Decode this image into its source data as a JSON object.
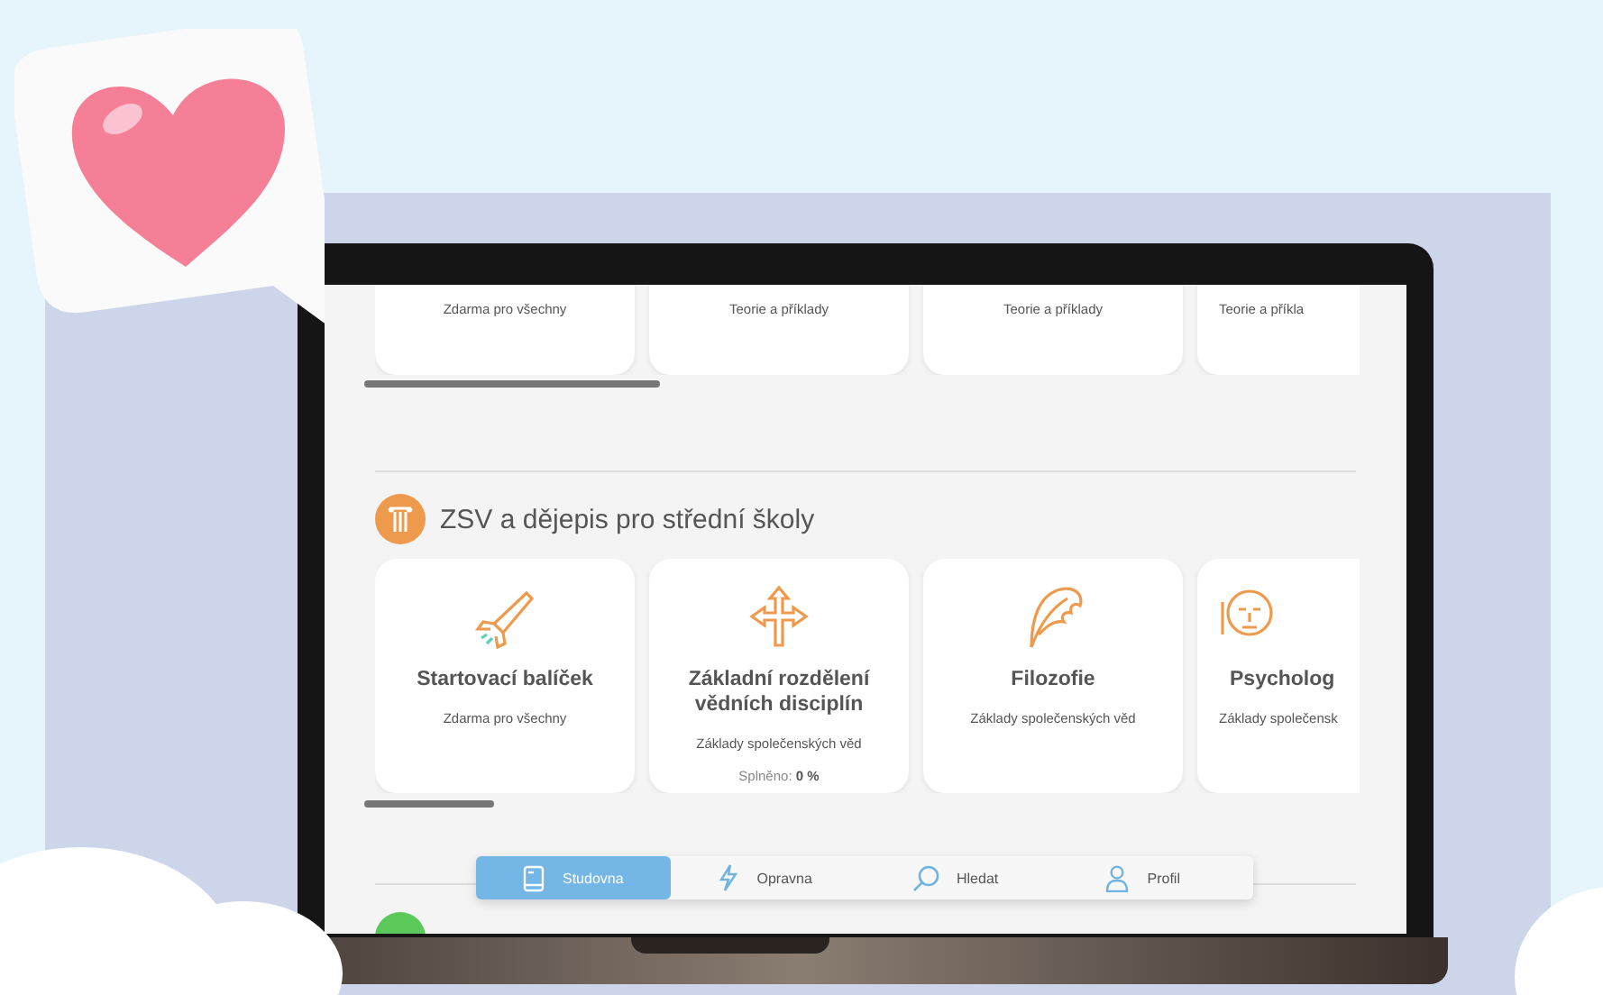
{
  "top_row": {
    "cards": [
      {
        "subtitle": "Zdarma pro všechny"
      },
      {
        "subtitle": "Teorie a příklady"
      },
      {
        "subtitle": "Teorie a příklady"
      },
      {
        "subtitle": "Teorie a příkla"
      }
    ]
  },
  "section": {
    "title": "ZSV a dějepis pro střední školy",
    "cards": [
      {
        "title": "Startovací balíček",
        "subtitle": "Zdarma pro všechny"
      },
      {
        "title": "Základní rozdělení vědních disciplín",
        "subtitle": "Základy společenských věd",
        "progress_label": "Splněno:",
        "progress_value": "0 %"
      },
      {
        "title": "Filozofie",
        "subtitle": "Základy společenských věd"
      },
      {
        "title": "Psycholog",
        "subtitle": "Základy společensk"
      }
    ]
  },
  "nav": [
    {
      "label": "Studovna",
      "selected": true
    },
    {
      "label": "Opravna",
      "selected": false
    },
    {
      "label": "Hledat",
      "selected": false
    },
    {
      "label": "Profil",
      "selected": false
    }
  ]
}
